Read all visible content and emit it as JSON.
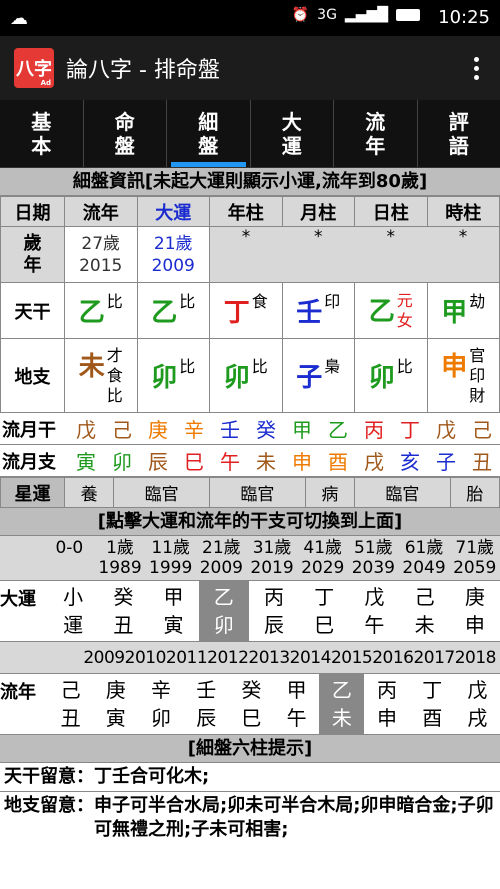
{
  "status": {
    "time": "10:25",
    "net": "3G"
  },
  "app": {
    "logo": "八字",
    "logo_sub": "Ad",
    "title": "論八字 - 排命盤"
  },
  "tabs": [
    {
      "l1": "基",
      "l2": "本"
    },
    {
      "l1": "命",
      "l2": "盤"
    },
    {
      "l1": "細",
      "l2": "盤"
    },
    {
      "l1": "大",
      "l2": "運"
    },
    {
      "l1": "流",
      "l2": "年"
    },
    {
      "l1": "評",
      "l2": "語"
    }
  ],
  "detail_header": "細盤資訊[未起大運則顯示小運,流年到80歲]",
  "cols": [
    "日期",
    "流年",
    "大運",
    "年柱",
    "月柱",
    "日柱",
    "時柱"
  ],
  "age_row": {
    "label1": "歲",
    "label2": "年",
    "liunian_age": "27歲",
    "liunian_year": "2015",
    "dayun_age": "21歲",
    "dayun_year": "2009",
    "star": "*"
  },
  "tiangan": {
    "label": "天干",
    "cells": [
      {
        "ch": "乙",
        "sup": "比",
        "color": "#1e9b1e",
        "supcolor": "#000"
      },
      {
        "ch": "乙",
        "sup": "比",
        "color": "#1e9b1e",
        "supcolor": "#000"
      },
      {
        "ch": "丁",
        "sup": "食",
        "color": "#e02020",
        "supcolor": "#000"
      },
      {
        "ch": "壬",
        "sup": "印",
        "color": "#1a2bd0",
        "supcolor": "#000"
      },
      {
        "ch": "乙",
        "sup": "元\n女",
        "color": "#1e9b1e",
        "supcolor": "#e02020"
      },
      {
        "ch": "甲",
        "sup": "劫",
        "color": "#1e9b1e",
        "supcolor": "#000"
      }
    ]
  },
  "dizhi": {
    "label": "地支",
    "cells": [
      {
        "ch": "未",
        "sup": "才\n食\n比",
        "color": "#a0581a"
      },
      {
        "ch": "卯",
        "sup": "比",
        "color": "#1e9b1e"
      },
      {
        "ch": "卯",
        "sup": "比",
        "color": "#1e9b1e"
      },
      {
        "ch": "子",
        "sup": "梟",
        "color": "#1a2bd0"
      },
      {
        "ch": "卯",
        "sup": "比",
        "color": "#1e9b1e"
      },
      {
        "ch": "申",
        "sup": "官\n印\n財",
        "color": "#ee7a00"
      }
    ]
  },
  "liuyue_gan": {
    "label": "流月干",
    "cells": [
      {
        "c": "戊",
        "k": "#a0581a"
      },
      {
        "c": "己",
        "k": "#a0581a"
      },
      {
        "c": "庚",
        "k": "#ee7a00"
      },
      {
        "c": "辛",
        "k": "#ee7a00"
      },
      {
        "c": "壬",
        "k": "#1a2bd0"
      },
      {
        "c": "癸",
        "k": "#1a2bd0"
      },
      {
        "c": "甲",
        "k": "#1e9b1e"
      },
      {
        "c": "乙",
        "k": "#1e9b1e"
      },
      {
        "c": "丙",
        "k": "#e02020"
      },
      {
        "c": "丁",
        "k": "#e02020"
      },
      {
        "c": "戊",
        "k": "#a0581a"
      },
      {
        "c": "己",
        "k": "#a0581a"
      }
    ]
  },
  "liuyue_zhi": {
    "label": "流月支",
    "cells": [
      {
        "c": "寅",
        "k": "#1e9b1e"
      },
      {
        "c": "卯",
        "k": "#1e9b1e"
      },
      {
        "c": "辰",
        "k": "#a0581a"
      },
      {
        "c": "巳",
        "k": "#e02020"
      },
      {
        "c": "午",
        "k": "#e02020"
      },
      {
        "c": "未",
        "k": "#a0581a"
      },
      {
        "c": "申",
        "k": "#ee7a00"
      },
      {
        "c": "酉",
        "k": "#ee7a00"
      },
      {
        "c": "戌",
        "k": "#a0581a"
      },
      {
        "c": "亥",
        "k": "#1a2bd0"
      },
      {
        "c": "子",
        "k": "#1a2bd0"
      },
      {
        "c": "丑",
        "k": "#a0581a"
      }
    ]
  },
  "xingyun": {
    "label": "星運",
    "cells": [
      "養",
      "臨官",
      "臨官",
      "病",
      "臨官",
      "胎"
    ]
  },
  "switch_header": "[點擊大運和流年的干支可切換到上面]",
  "dayun_ages": [
    {
      "a": "0-0",
      "y": ""
    },
    {
      "a": "1歲",
      "y": "1989"
    },
    {
      "a": "11歲",
      "y": "1999"
    },
    {
      "a": "21歲",
      "y": "2009"
    },
    {
      "a": "31歲",
      "y": "2019"
    },
    {
      "a": "41歲",
      "y": "2029"
    },
    {
      "a": "51歲",
      "y": "2039"
    },
    {
      "a": "61歲",
      "y": "2049"
    },
    {
      "a": "71歲",
      "y": "2059"
    }
  ],
  "dayun": {
    "label": "大運",
    "cells": [
      {
        "t": "小",
        "b": "運"
      },
      {
        "t": "癸",
        "b": "丑"
      },
      {
        "t": "甲",
        "b": "寅"
      },
      {
        "t": "乙",
        "b": "卯"
      },
      {
        "t": "丙",
        "b": "辰"
      },
      {
        "t": "丁",
        "b": "巳"
      },
      {
        "t": "戊",
        "b": "午"
      },
      {
        "t": "己",
        "b": "未"
      },
      {
        "t": "庚",
        "b": "申"
      }
    ]
  },
  "liunian_years": "2009201020112012201320142015201620172018",
  "liunian": {
    "label": "流年",
    "cells": [
      {
        "t": "己",
        "b": "丑"
      },
      {
        "t": "庚",
        "b": "寅"
      },
      {
        "t": "辛",
        "b": "卯"
      },
      {
        "t": "壬",
        "b": "辰"
      },
      {
        "t": "癸",
        "b": "巳"
      },
      {
        "t": "甲",
        "b": "午"
      },
      {
        "t": "乙",
        "b": "未"
      },
      {
        "t": "丙",
        "b": "申"
      },
      {
        "t": "丁",
        "b": "酉"
      },
      {
        "t": "戊",
        "b": "戌"
      }
    ]
  },
  "six_header": "[細盤六柱提示]",
  "notes": [
    {
      "label": "天干留意：",
      "text": "丁壬合可化木;"
    },
    {
      "label": "地支留意：",
      "text": "申子可半合水局;卯未可半合木局;卯申暗合金;子卯可無禮之刑;子未可相害;"
    }
  ]
}
